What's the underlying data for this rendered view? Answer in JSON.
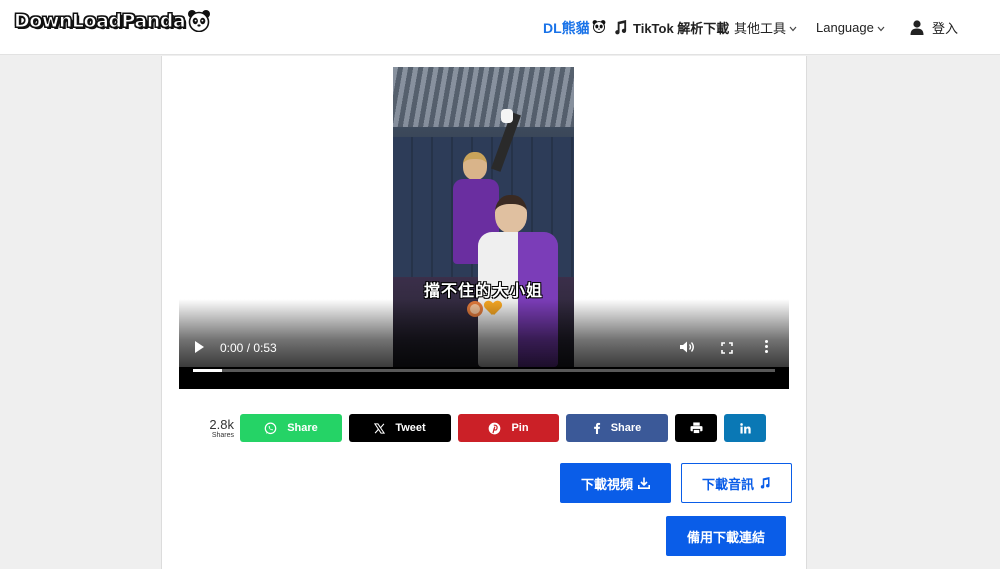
{
  "header": {
    "logo_text": "DownLoadPanda",
    "nav": {
      "brand": "DL熊貓",
      "tiktok": "TikTok 解析下載",
      "tools": "其他工具",
      "language": "Language",
      "login": "登入"
    }
  },
  "video": {
    "caption": "擋不住的大小姐",
    "time_display": "0:00 / 0:53",
    "progress_loaded": 0.05
  },
  "share": {
    "count": "2.8k",
    "count_label": "Shares",
    "buttons": {
      "whatsapp": "Share",
      "twitter": "Tweet",
      "pinterest": "Pin",
      "facebook": "Share"
    },
    "colors": {
      "whatsapp": "#25d366",
      "twitter": "#000000",
      "pinterest": "#cb2027",
      "facebook": "#3b5998",
      "print": "#000000",
      "linkedin": "#0a78b5"
    }
  },
  "downloads": {
    "video": "下載視頻",
    "audio": "下載音訊",
    "backup": "備用下載連結"
  },
  "colors": {
    "accent": "#0a5de8",
    "page_bg": "#efefef"
  },
  "icons": [
    "panda-icon",
    "music-note-icon",
    "chevron-down-icon",
    "user-icon",
    "play-icon",
    "volume-icon",
    "fullscreen-icon",
    "more-vert-icon",
    "whatsapp-icon",
    "x-twitter-icon",
    "pinterest-icon",
    "facebook-icon",
    "print-icon",
    "linkedin-icon",
    "download-icon"
  ]
}
